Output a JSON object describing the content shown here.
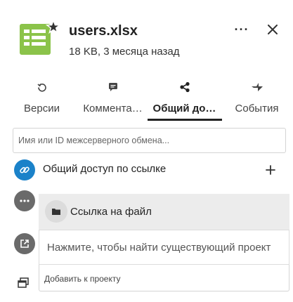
{
  "file": {
    "name": "users.xlsx",
    "meta": "18 KB, 3 месяца назад",
    "icon": "spreadsheet-favorite-icon"
  },
  "header": {
    "more_label": "···",
    "close_icon": "close-icon"
  },
  "tabs": [
    {
      "label": "Версии",
      "icon": "history-icon",
      "active": false
    },
    {
      "label": "Коммента…",
      "icon": "comment-icon",
      "active": false
    },
    {
      "label": "Общий до…",
      "icon": "share-icon",
      "active": true
    },
    {
      "label": "События",
      "icon": "activity-icon",
      "active": false
    }
  ],
  "sharing": {
    "search_placeholder": "Имя или ID межсерверного обмена...",
    "link_share_label": "Общий доступ по ссылке",
    "add_link_icon": "plus-icon"
  },
  "links": {
    "file_link_label": "Ссылка на файл",
    "project_search_label": "Нажмите, чтобы найти существующий проект",
    "add_to_project_label": "Добавить к проекту"
  },
  "colors": {
    "accent": "#1b82c9",
    "grey_circle": "#6a6a6a",
    "file_icon_green": "#8bc34a",
    "row_highlight": "#ececec"
  }
}
